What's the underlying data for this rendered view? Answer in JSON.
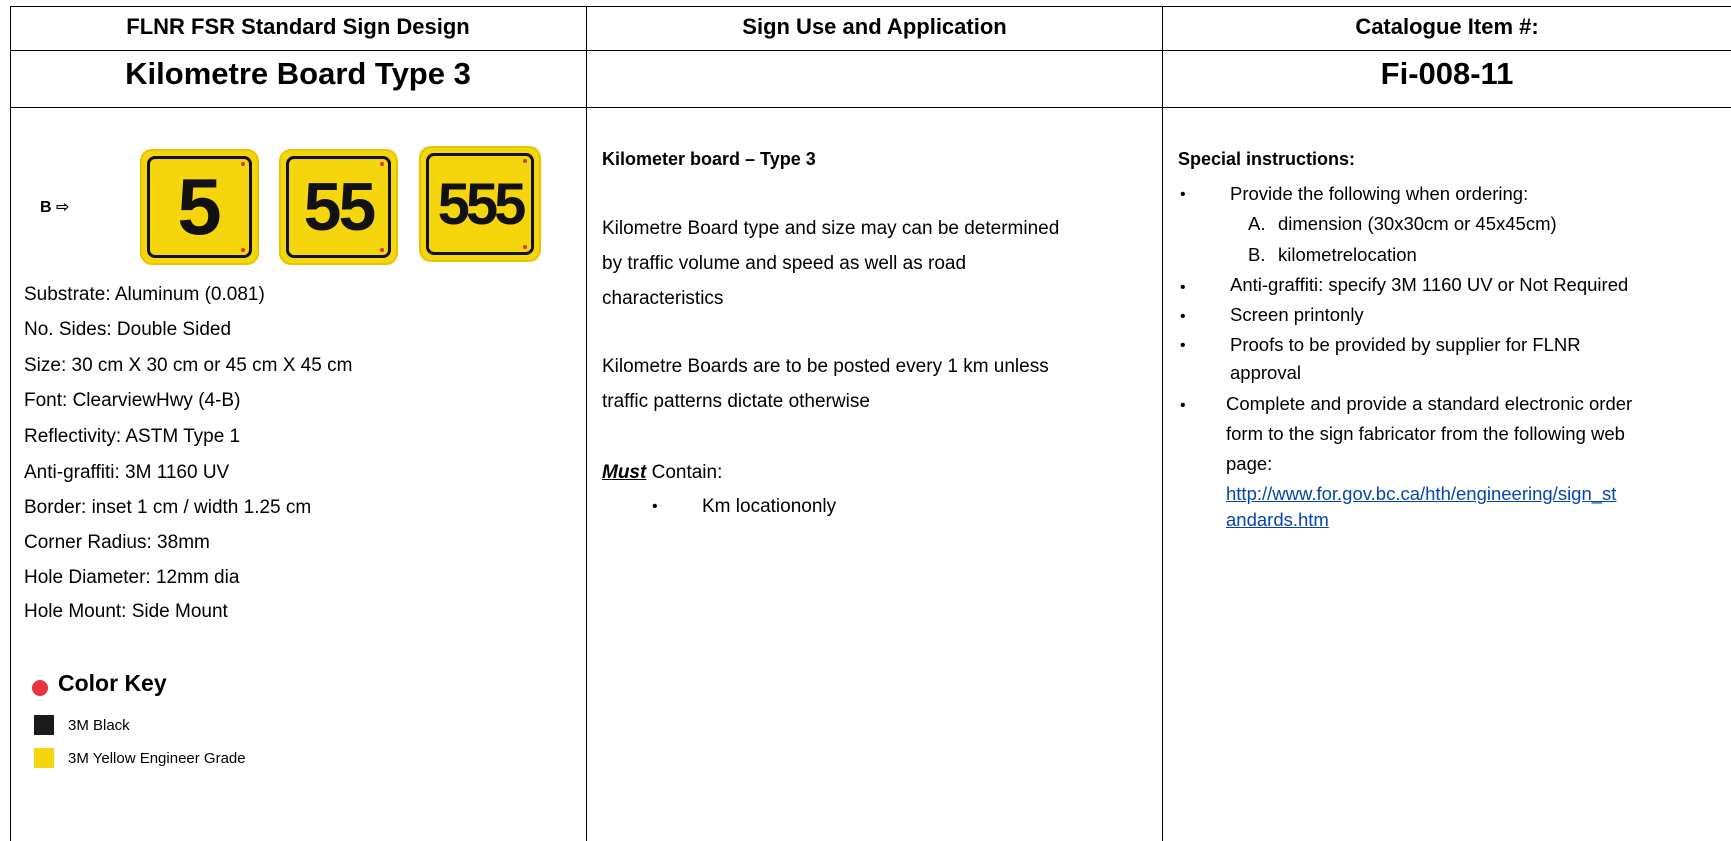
{
  "header": {
    "col1_title": "FLNR FSR Standard Sign Design",
    "col1_subtitle": "Kilometre Board Type 3",
    "col2_title": "Sign Use and Application",
    "col3_title": "Catalogue Item #:",
    "col3_subtitle": "Fi-008-11"
  },
  "signs": {
    "b_label": "B ⇨",
    "examples": [
      "5",
      "55",
      "555"
    ],
    "sign_color": "#f5d60c"
  },
  "specs": [
    "Substrate: Aluminum (0.081)",
    "No. Sides: Double Sided",
    "Size: 30 cm X 30 cm or 45 cm X 45 cm",
    "Font: ClearviewHwy (4-B)",
    "Reflectivity: ASTM Type 1",
    "Anti-graffiti: 3M 1160 UV",
    "Border: inset 1 cm / width 1.25 cm",
    "Corner Radius: 38mm",
    "Hole Diameter: 12mm dia",
    "Hole Mount: Side Mount"
  ],
  "color_key": {
    "title": "Color Key",
    "dot_color": "#e8343f",
    "items": [
      {
        "label": "3M Black",
        "color": "#1a1a1a"
      },
      {
        "label": "3M Yellow Engineer Grade",
        "color": "#f5d60c"
      }
    ]
  },
  "use": {
    "heading": "Kilometer board – Type 3",
    "para1_line1": "Kilometre Board type and size may can be determined",
    "para1_line2": "by traffic volume and speed as well as road",
    "para1_line3": "characteristics",
    "para2_line1": "Kilometre Boards are to be posted every 1 km unless",
    "para2_line2": "traffic patterns dictate otherwise",
    "must": "Must",
    "contain": " Contain:",
    "bullet": "Km locationonly"
  },
  "instructions": {
    "heading": "Special instructions:",
    "item1": "Provide the following when ordering:",
    "sub_a_letter": "A.",
    "sub_a": "dimension (30x30cm or 45x45cm)",
    "sub_b_letter": "B.",
    "sub_b": "kilometrelocation",
    "item2": "Anti-graffiti: specify 3M 1160 UV or Not Required",
    "item3": "Screen printonly",
    "item4_line1": "Proofs to be provided by supplier for FLNR",
    "item4_line2": "approval",
    "item5_line1": "Complete and provide a standard electronic order",
    "item5_line2": "form to the sign fabricator from the following web",
    "item5_line3": "page:",
    "link_line1": "http://www.for.gov.bc.ca/hth/engineering/sign_st",
    "link_line2": "andards.htm"
  }
}
